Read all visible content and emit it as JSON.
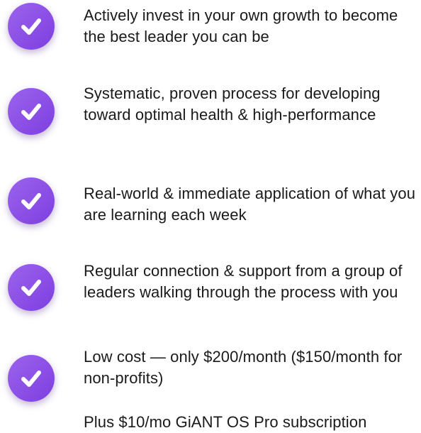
{
  "brand_color": "#8a4de6",
  "icon": "check-circle-icon",
  "benefits": [
    {
      "text": "Actively invest in your own growth to become the best leader you can be"
    },
    {
      "text": "Systematic, proven process for developing toward optimal health & high-performance"
    },
    {
      "text": "Real-world & immediate application of what you are learning each week"
    },
    {
      "text": "Regular connection & support from a group of leaders walking through the process with you"
    },
    {
      "text": "Low cost — only $200/month ($150/month for non-profits)"
    }
  ],
  "footnote": "Plus $10/mo GiANT OS Pro subscription"
}
